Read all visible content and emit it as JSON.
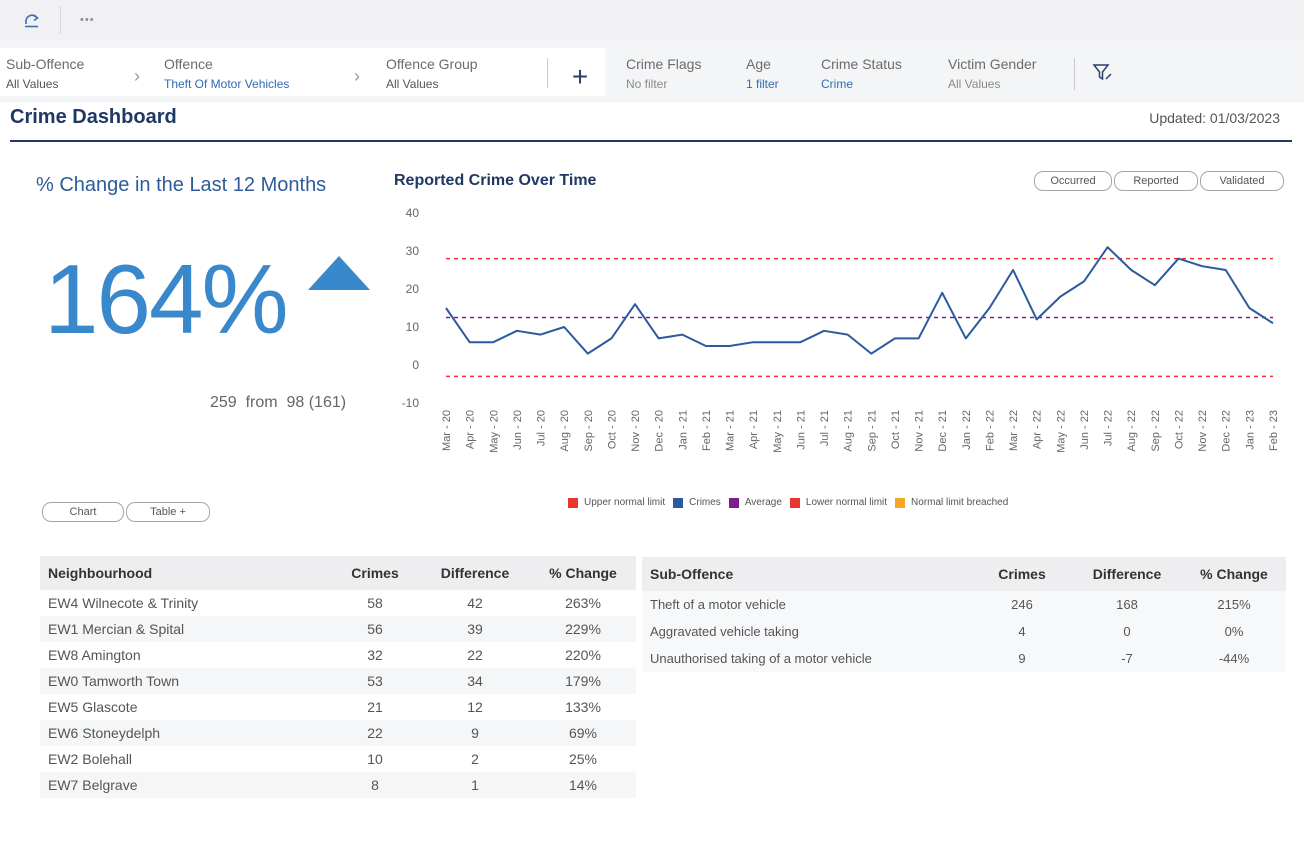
{
  "toolbar": {
    "refresh_icon": "refresh-icon",
    "more_label": "•••"
  },
  "filters": {
    "crumbs": [
      {
        "label": "Sub-Offence",
        "value": "All Values"
      },
      {
        "label": "Offence",
        "value": "Theft Of Motor Vehicles"
      },
      {
        "label": "Offence Group",
        "value": "All Values"
      }
    ],
    "add_label": "+",
    "fields": [
      {
        "label": "Crime Flags",
        "value": "No filter"
      },
      {
        "label": "Age",
        "value": "1 filter"
      },
      {
        "label": "Crime Status",
        "value": "Crime"
      },
      {
        "label": "Victim Gender",
        "value": "All Values"
      }
    ]
  },
  "header": {
    "title": "Crime Dashboard",
    "updated": "Updated: 01/03/2023"
  },
  "kpi": {
    "title": "% Change in the Last 12 Months",
    "value": "164%",
    "subtitle": "259  from  98 (161)",
    "direction": "up"
  },
  "chart_title": "Reported Crime Over Time",
  "date_buttons": [
    "Occurred",
    "Reported",
    "Validated"
  ],
  "view_buttons": [
    "Chart",
    "Table +"
  ],
  "legend": [
    {
      "label": "Upper normal limit",
      "color": "#e8372f"
    },
    {
      "label": "Crimes",
      "color": "#2b5a9e"
    },
    {
      "label": "Average",
      "color": "#7b1f8c"
    },
    {
      "label": "Lower normal limit",
      "color": "#e8372f"
    },
    {
      "label": "Normal limit breached",
      "color": "#f5a623"
    }
  ],
  "chart_data": {
    "type": "line",
    "title": "Reported Crime Over Time",
    "x": [
      "Mar - 20",
      "Apr - 20",
      "May - 20",
      "Jun - 20",
      "Jul - 20",
      "Aug - 20",
      "Sep - 20",
      "Oct - 20",
      "Nov - 20",
      "Dec - 20",
      "Jan - 21",
      "Feb - 21",
      "Mar - 21",
      "Apr - 21",
      "May - 21",
      "Jun - 21",
      "Jul - 21",
      "Aug - 21",
      "Sep - 21",
      "Oct - 21",
      "Nov - 21",
      "Dec - 21",
      "Jan - 22",
      "Feb - 22",
      "Mar - 22",
      "Apr - 22",
      "May - 22",
      "Jun - 22",
      "Jul - 22",
      "Aug - 22",
      "Sep - 22",
      "Oct - 22",
      "Nov - 22",
      "Dec - 22",
      "Jan - 23",
      "Feb - 23"
    ],
    "series": [
      {
        "name": "Crimes",
        "color": "#2b5a9e",
        "values": [
          15,
          6,
          6,
          9,
          8,
          10,
          3,
          7,
          16,
          7,
          8,
          5,
          5,
          6,
          6,
          6,
          9,
          8,
          3,
          7,
          7,
          19,
          7,
          15,
          25,
          12,
          18,
          22,
          31,
          25,
          21,
          28,
          26,
          25,
          15,
          11
        ]
      },
      {
        "name": "Upper normal limit",
        "color": "#e8372f",
        "constant": 28
      },
      {
        "name": "Average",
        "color": "#7b1f8c",
        "constant": 12.5
      },
      {
        "name": "Lower normal limit",
        "color": "#e8372f",
        "constant": -3
      }
    ],
    "yticks": [
      40,
      30,
      20,
      10,
      0,
      -10
    ],
    "ylim": [
      -10,
      40
    ],
    "grid": false
  },
  "neighbourhood_table": {
    "headers": [
      "Neighbourhood",
      "Crimes",
      "Difference",
      "% Change"
    ],
    "rows": [
      [
        "EW4 Wilnecote & Trinity",
        "58",
        "42",
        "263%"
      ],
      [
        "EW1 Mercian & Spital",
        "56",
        "39",
        "229%"
      ],
      [
        "EW8 Amington",
        "32",
        "22",
        "220%"
      ],
      [
        "EW0 Tamworth Town",
        "53",
        "34",
        "179%"
      ],
      [
        "EW5 Glascote",
        "21",
        "12",
        "133%"
      ],
      [
        "EW6 Stoneydelph",
        "22",
        "9",
        "69%"
      ],
      [
        "EW2 Bolehall",
        "10",
        "2",
        "25%"
      ],
      [
        "EW7 Belgrave",
        "8",
        "1",
        "14%"
      ]
    ]
  },
  "suboffence_table": {
    "headers": [
      "Sub-Offence",
      "Crimes",
      "Difference",
      "% Change"
    ],
    "rows": [
      [
        "Theft of a motor vehicle",
        "246",
        "168",
        "215%"
      ],
      [
        "Aggravated vehicle taking",
        "4",
        "0",
        "0%"
      ],
      [
        "Unauthorised taking of a motor vehicle",
        "9",
        "-7",
        "-44%"
      ]
    ]
  }
}
